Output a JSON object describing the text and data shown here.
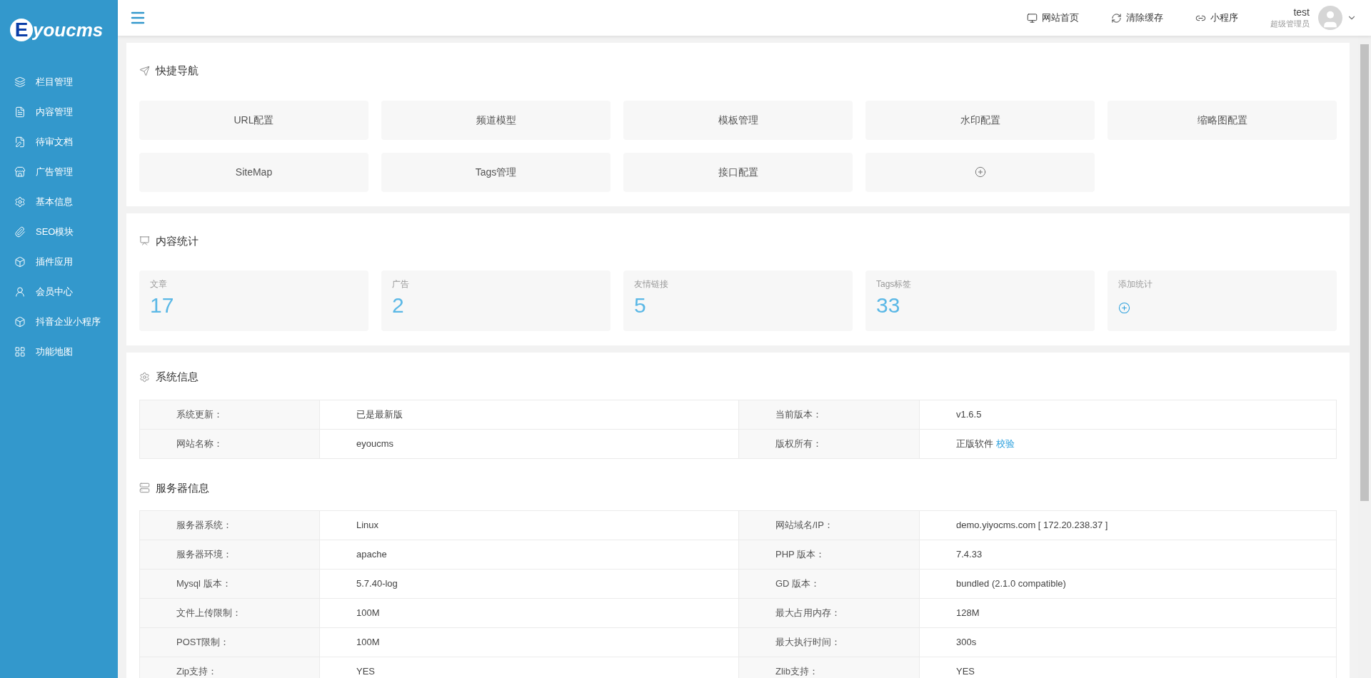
{
  "logo": {
    "initial": "E",
    "rest": "youcms"
  },
  "sidebar": {
    "items": [
      {
        "label": "栏目管理",
        "selected": false
      },
      {
        "label": "内容管理",
        "selected": false
      },
      {
        "label": "待审文档",
        "selected": false
      },
      {
        "label": "广告管理",
        "selected": false
      },
      {
        "label": "基本信息",
        "selected": false
      },
      {
        "label": "SEO模块",
        "selected": false
      },
      {
        "label": "插件应用",
        "selected": false
      },
      {
        "label": "会员中心",
        "selected": false
      },
      {
        "label": "抖音企业小程序",
        "selected": false
      },
      {
        "label": "功能地图",
        "selected": false
      }
    ]
  },
  "header": {
    "links": [
      "网站首页",
      "清除缓存",
      "小程序"
    ],
    "user": {
      "name": "test",
      "role": "超级管理员"
    }
  },
  "quick_nav": {
    "title": "快捷导航",
    "items": [
      {
        "kind": "link",
        "label": "URL配置"
      },
      {
        "kind": "link",
        "label": "频道模型"
      },
      {
        "kind": "link",
        "label": "模板管理"
      },
      {
        "kind": "link",
        "label": "水印配置"
      },
      {
        "kind": "link",
        "label": "缩略图配置"
      },
      {
        "kind": "link",
        "label": "SiteMap"
      },
      {
        "kind": "link",
        "label": "Tags管理"
      },
      {
        "kind": "link",
        "label": "接口配置"
      },
      {
        "kind": "add"
      }
    ]
  },
  "stats": {
    "title": "内容统计",
    "items": [
      {
        "kind": "count",
        "label": "文章",
        "value": "17"
      },
      {
        "kind": "count",
        "label": "广告",
        "value": "2"
      },
      {
        "kind": "count",
        "label": "友情链接",
        "value": "5"
      },
      {
        "kind": "count",
        "label": "Tags标签",
        "value": "33"
      },
      {
        "kind": "add",
        "label": "添加统计"
      }
    ]
  },
  "system_info": {
    "title": "系统信息",
    "rows": [
      [
        {
          "label": "系统更新：",
          "value": "已是最新版"
        },
        {
          "label": "当前版本：",
          "value": "v1.6.5"
        }
      ],
      [
        {
          "label": "网站名称：",
          "value": "eyoucms"
        },
        {
          "label": "版权所有：",
          "value": "正版软件",
          "link": "校验"
        }
      ]
    ]
  },
  "server_info": {
    "title": "服务器信息",
    "rows": [
      [
        {
          "label": "服务器系统：",
          "value": "Linux"
        },
        {
          "label": "网站域名/IP：",
          "value": "demo.yiyocms.com [ 172.20.238.37 ]"
        }
      ],
      [
        {
          "label": "服务器环境：",
          "value": "apache"
        },
        {
          "label": "PHP 版本：",
          "value": "7.4.33"
        }
      ],
      [
        {
          "label": "Mysql 版本：",
          "value": "5.7.40-log"
        },
        {
          "label": "GD 版本：",
          "value": "bundled (2.1.0 compatible)"
        }
      ],
      [
        {
          "label": "文件上传限制：",
          "value": "100M"
        },
        {
          "label": "最大占用内存：",
          "value": "128M"
        }
      ],
      [
        {
          "label": "POST限制：",
          "value": "100M"
        },
        {
          "label": "最大执行时间：",
          "value": "300s"
        }
      ],
      [
        {
          "label": "Zip支持：",
          "value": "YES"
        },
        {
          "label": "Zlib支持：",
          "value": "YES"
        }
      ]
    ]
  }
}
